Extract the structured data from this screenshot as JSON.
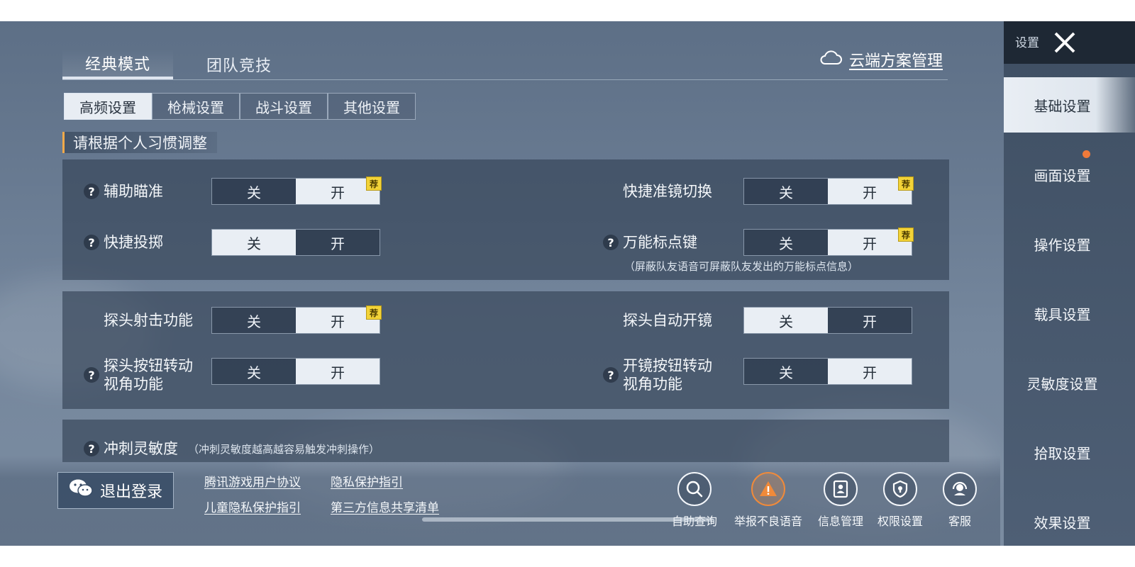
{
  "top_tabs": {
    "classic": "经典模式",
    "team": "团队竞技"
  },
  "cloud_mgmt": "云端方案管理",
  "sub_tabs": [
    "高频设置",
    "枪械设置",
    "战斗设置",
    "其他设置"
  ],
  "hint": "请根据个人习惯调整",
  "toggle": {
    "off": "关",
    "on": "开",
    "recommended": "荐"
  },
  "settings": {
    "aim_assist": "辅助瞄准",
    "quick_throw": "快捷投掷",
    "scope_switch": "快捷准镜切换",
    "universal_mark": "万能标点键",
    "universal_mark_note": "（屏蔽队友语音可屏蔽队友发出的万能标点信息）",
    "peek_fire": "探头射击功能",
    "peek_auto_scope": "探头自动开镜",
    "peek_btn_turn_1": "探头按钮转动",
    "peek_btn_turn_2": "视角功能",
    "scope_btn_turn_1": "开镜按钮转动",
    "scope_btn_turn_2": "视角功能",
    "sprint_sens": "冲刺灵敏度",
    "sprint_sens_note": "（冲刺灵敏度越高越容易触发冲刺操作）"
  },
  "bottom": {
    "logout": "退出登录",
    "links": [
      "腾讯游戏用户协议",
      "隐私保护指引",
      "儿童隐私保护指引",
      "第三方信息共享清单"
    ],
    "services": [
      "自助查询",
      "举报不良语音",
      "信息管理",
      "权限设置",
      "客服"
    ]
  },
  "sidebar": {
    "title": "设置",
    "items": [
      "基础设置",
      "画面设置",
      "操作设置",
      "载具设置",
      "灵敏度设置",
      "拾取设置",
      "效果设置"
    ]
  },
  "colors": {
    "accent": "#f0a94a",
    "badge": "#f3d338",
    "notify_dot": "#f07a3a",
    "warn_icon": "#f08a3a"
  }
}
